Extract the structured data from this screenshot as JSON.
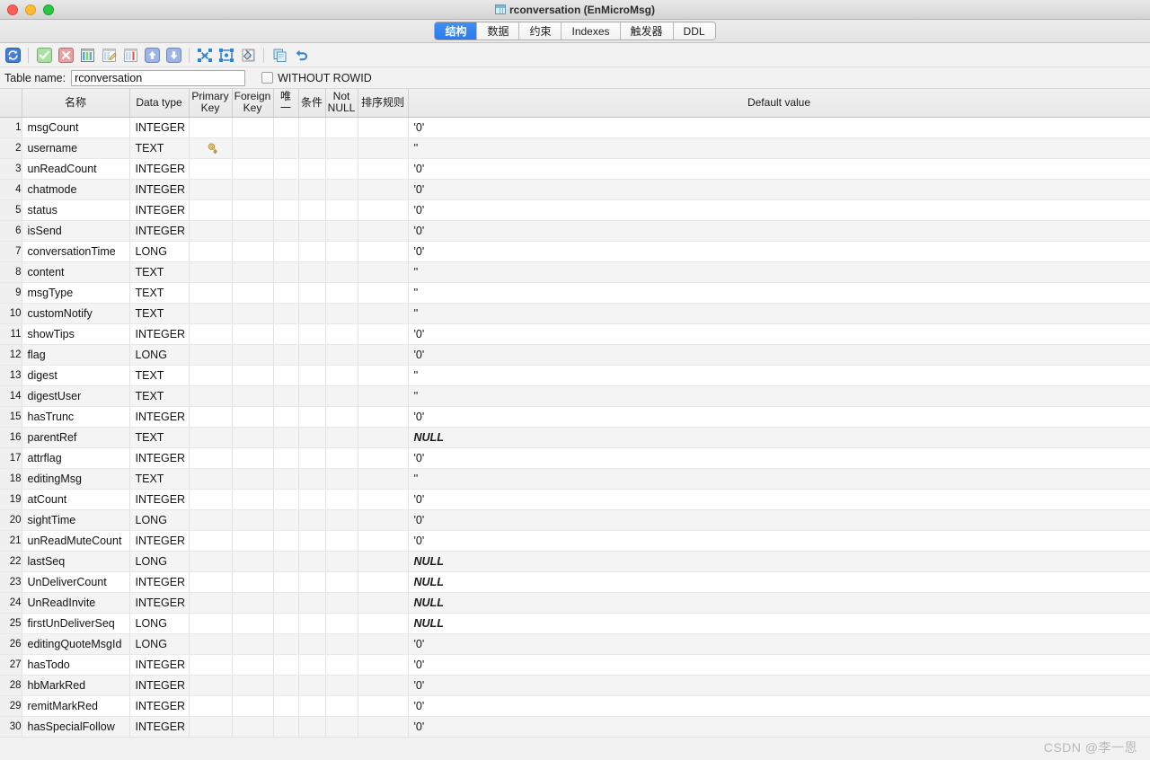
{
  "window": {
    "title": "rconversation (EnMicroMsg)",
    "title_icon": "table-icon",
    "controls": {
      "close": "close-button",
      "minimize": "minimize-button",
      "zoom": "zoom-button"
    }
  },
  "tabs": [
    {
      "label": "结构",
      "active": true
    },
    {
      "label": "数据",
      "active": false
    },
    {
      "label": "约束",
      "active": false
    },
    {
      "label": "Indexes",
      "active": false
    },
    {
      "label": "触发器",
      "active": false
    },
    {
      "label": "DDL",
      "active": false
    }
  ],
  "toolbar": {
    "buttons": [
      {
        "name": "refresh-icon",
        "icon": "refresh"
      },
      {
        "name": "commit-icon",
        "icon": "check"
      },
      {
        "name": "rollback-icon",
        "icon": "cross"
      },
      {
        "name": "add-field-icon",
        "icon": "add-column"
      },
      {
        "name": "edit-field-icon",
        "icon": "edit-column"
      },
      {
        "name": "delete-field-icon",
        "icon": "delete-column"
      },
      {
        "name": "move-up-icon",
        "icon": "arrow-up"
      },
      {
        "name": "move-down-icon",
        "icon": "arrow-down"
      },
      {
        "name": "collapse-all-icon",
        "icon": "collapse"
      },
      {
        "name": "expand-all-icon",
        "icon": "expand"
      },
      {
        "name": "fill-icon",
        "icon": "paint"
      },
      {
        "name": "copy-icon",
        "icon": "copy"
      },
      {
        "name": "undo-icon",
        "icon": "undo"
      }
    ]
  },
  "table_name_bar": {
    "label": "Table name:",
    "value": "rconversation",
    "placeholder": "",
    "without_rowid_label": "WITHOUT ROWID",
    "without_rowid_checked": false
  },
  "grid": {
    "headers": {
      "rownum": "",
      "name": "名称",
      "data_type": "Data type",
      "primary_key": "Primary Key",
      "foreign_key": "Foreign Key",
      "unique": "唯一",
      "check": "条件",
      "not_null": "Not NULL",
      "collate": "排序规则",
      "default_value": "Default value"
    },
    "rows": [
      {
        "n": "1",
        "name": "msgCount",
        "type": "INTEGER",
        "pk": false,
        "fk": "",
        "unique": "",
        "check": "",
        "notnull": "",
        "collate": "",
        "default": "'0'",
        "null": false
      },
      {
        "n": "2",
        "name": "username",
        "type": "TEXT",
        "pk": true,
        "fk": "",
        "unique": "",
        "check": "",
        "notnull": "",
        "collate": "",
        "default": "''",
        "null": false
      },
      {
        "n": "3",
        "name": "unReadCount",
        "type": "INTEGER",
        "pk": false,
        "fk": "",
        "unique": "",
        "check": "",
        "notnull": "",
        "collate": "",
        "default": "'0'",
        "null": false
      },
      {
        "n": "4",
        "name": "chatmode",
        "type": "INTEGER",
        "pk": false,
        "fk": "",
        "unique": "",
        "check": "",
        "notnull": "",
        "collate": "",
        "default": "'0'",
        "null": false
      },
      {
        "n": "5",
        "name": "status",
        "type": "INTEGER",
        "pk": false,
        "fk": "",
        "unique": "",
        "check": "",
        "notnull": "",
        "collate": "",
        "default": "'0'",
        "null": false
      },
      {
        "n": "6",
        "name": "isSend",
        "type": "INTEGER",
        "pk": false,
        "fk": "",
        "unique": "",
        "check": "",
        "notnull": "",
        "collate": "",
        "default": "'0'",
        "null": false
      },
      {
        "n": "7",
        "name": "conversationTime",
        "type": "LONG",
        "pk": false,
        "fk": "",
        "unique": "",
        "check": "",
        "notnull": "",
        "collate": "",
        "default": "'0'",
        "null": false
      },
      {
        "n": "8",
        "name": "content",
        "type": "TEXT",
        "pk": false,
        "fk": "",
        "unique": "",
        "check": "",
        "notnull": "",
        "collate": "",
        "default": "''",
        "null": false
      },
      {
        "n": "9",
        "name": "msgType",
        "type": "TEXT",
        "pk": false,
        "fk": "",
        "unique": "",
        "check": "",
        "notnull": "",
        "collate": "",
        "default": "''",
        "null": false
      },
      {
        "n": "10",
        "name": "customNotify",
        "type": "TEXT",
        "pk": false,
        "fk": "",
        "unique": "",
        "check": "",
        "notnull": "",
        "collate": "",
        "default": "''",
        "null": false
      },
      {
        "n": "11",
        "name": "showTips",
        "type": "INTEGER",
        "pk": false,
        "fk": "",
        "unique": "",
        "check": "",
        "notnull": "",
        "collate": "",
        "default": "'0'",
        "null": false
      },
      {
        "n": "12",
        "name": "flag",
        "type": "LONG",
        "pk": false,
        "fk": "",
        "unique": "",
        "check": "",
        "notnull": "",
        "collate": "",
        "default": "'0'",
        "null": false
      },
      {
        "n": "13",
        "name": "digest",
        "type": "TEXT",
        "pk": false,
        "fk": "",
        "unique": "",
        "check": "",
        "notnull": "",
        "collate": "",
        "default": "''",
        "null": false
      },
      {
        "n": "14",
        "name": "digestUser",
        "type": "TEXT",
        "pk": false,
        "fk": "",
        "unique": "",
        "check": "",
        "notnull": "",
        "collate": "",
        "default": "''",
        "null": false
      },
      {
        "n": "15",
        "name": "hasTrunc",
        "type": "INTEGER",
        "pk": false,
        "fk": "",
        "unique": "",
        "check": "",
        "notnull": "",
        "collate": "",
        "default": "'0'",
        "null": false
      },
      {
        "n": "16",
        "name": "parentRef",
        "type": "TEXT",
        "pk": false,
        "fk": "",
        "unique": "",
        "check": "",
        "notnull": "",
        "collate": "",
        "default": "NULL",
        "null": true
      },
      {
        "n": "17",
        "name": "attrflag",
        "type": "INTEGER",
        "pk": false,
        "fk": "",
        "unique": "",
        "check": "",
        "notnull": "",
        "collate": "",
        "default": "'0'",
        "null": false
      },
      {
        "n": "18",
        "name": "editingMsg",
        "type": "TEXT",
        "pk": false,
        "fk": "",
        "unique": "",
        "check": "",
        "notnull": "",
        "collate": "",
        "default": "''",
        "null": false
      },
      {
        "n": "19",
        "name": "atCount",
        "type": "INTEGER",
        "pk": false,
        "fk": "",
        "unique": "",
        "check": "",
        "notnull": "",
        "collate": "",
        "default": "'0'",
        "null": false
      },
      {
        "n": "20",
        "name": "sightTime",
        "type": "LONG",
        "pk": false,
        "fk": "",
        "unique": "",
        "check": "",
        "notnull": "",
        "collate": "",
        "default": "'0'",
        "null": false
      },
      {
        "n": "21",
        "name": "unReadMuteCount",
        "type": "INTEGER",
        "pk": false,
        "fk": "",
        "unique": "",
        "check": "",
        "notnull": "",
        "collate": "",
        "default": "'0'",
        "null": false
      },
      {
        "n": "22",
        "name": "lastSeq",
        "type": "LONG",
        "pk": false,
        "fk": "",
        "unique": "",
        "check": "",
        "notnull": "",
        "collate": "",
        "default": "NULL",
        "null": true
      },
      {
        "n": "23",
        "name": "UnDeliverCount",
        "type": "INTEGER",
        "pk": false,
        "fk": "",
        "unique": "",
        "check": "",
        "notnull": "",
        "collate": "",
        "default": "NULL",
        "null": true
      },
      {
        "n": "24",
        "name": "UnReadInvite",
        "type": "INTEGER",
        "pk": false,
        "fk": "",
        "unique": "",
        "check": "",
        "notnull": "",
        "collate": "",
        "default": "NULL",
        "null": true
      },
      {
        "n": "25",
        "name": "firstUnDeliverSeq",
        "type": "LONG",
        "pk": false,
        "fk": "",
        "unique": "",
        "check": "",
        "notnull": "",
        "collate": "",
        "default": "NULL",
        "null": true
      },
      {
        "n": "26",
        "name": "editingQuoteMsgId",
        "type": "LONG",
        "pk": false,
        "fk": "",
        "unique": "",
        "check": "",
        "notnull": "",
        "collate": "",
        "default": "'0'",
        "null": false
      },
      {
        "n": "27",
        "name": "hasTodo",
        "type": "INTEGER",
        "pk": false,
        "fk": "",
        "unique": "",
        "check": "",
        "notnull": "",
        "collate": "",
        "default": "'0'",
        "null": false
      },
      {
        "n": "28",
        "name": "hbMarkRed",
        "type": "INTEGER",
        "pk": false,
        "fk": "",
        "unique": "",
        "check": "",
        "notnull": "",
        "collate": "",
        "default": "'0'",
        "null": false
      },
      {
        "n": "29",
        "name": "remitMarkRed",
        "type": "INTEGER",
        "pk": false,
        "fk": "",
        "unique": "",
        "check": "",
        "notnull": "",
        "collate": "",
        "default": "'0'",
        "null": false
      },
      {
        "n": "30",
        "name": "hasSpecialFollow",
        "type": "INTEGER",
        "pk": false,
        "fk": "",
        "unique": "",
        "check": "",
        "notnull": "",
        "collate": "",
        "default": "'0'",
        "null": false
      }
    ]
  },
  "footer": {
    "watermark": "CSDN @李一恩"
  },
  "colors": {
    "accent": "#2a7ced",
    "header_bg": "#ececec",
    "row_alt_bg": "#f4f4f4",
    "key_icon": "#e8c76a"
  }
}
